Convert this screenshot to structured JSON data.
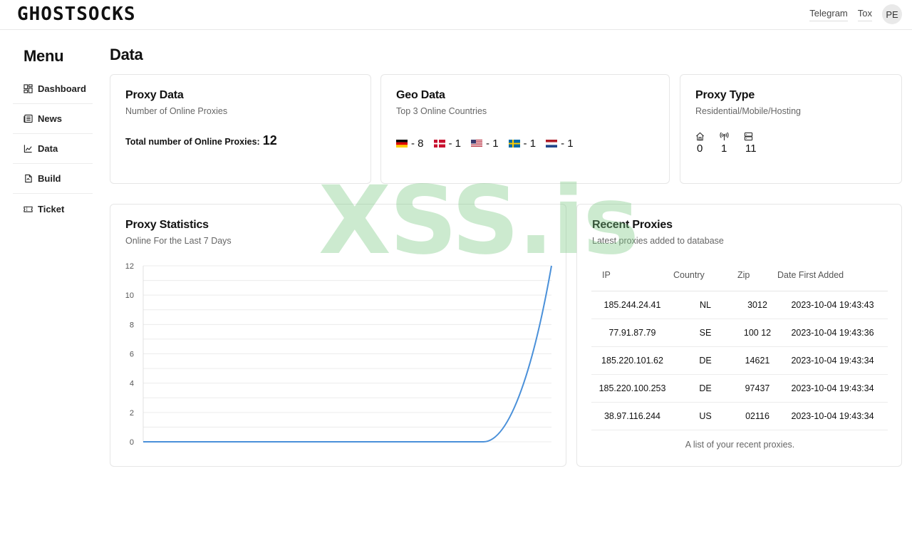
{
  "header": {
    "logo_text": "GHOSTSOCKS",
    "links": [
      "Telegram",
      "Tox"
    ],
    "avatar_initials": "PE"
  },
  "sidebar": {
    "title": "Menu",
    "items": [
      {
        "label": "Dashboard",
        "icon": "dashboard-icon"
      },
      {
        "label": "News",
        "icon": "newspaper-icon"
      },
      {
        "label": "Data",
        "icon": "chart-icon"
      },
      {
        "label": "Build",
        "icon": "file-build-icon"
      },
      {
        "label": "Ticket",
        "icon": "ticket-icon"
      }
    ]
  },
  "page_title": "Data",
  "proxy_data": {
    "title": "Proxy Data",
    "subtitle": "Number of Online Proxies",
    "total_label": "Total number of Online Proxies:",
    "total_value": "12"
  },
  "geo_data": {
    "title": "Geo Data",
    "subtitle": "Top 3 Online Countries",
    "countries": [
      {
        "code": "DE",
        "count": "- 8"
      },
      {
        "code": "DK",
        "count": "- 1"
      },
      {
        "code": "US",
        "count": "- 1"
      },
      {
        "code": "SE",
        "count": "- 1"
      },
      {
        "code": "NL",
        "count": "- 1"
      }
    ]
  },
  "proxy_type": {
    "title": "Proxy Type",
    "subtitle": "Residential/Mobile/Hosting",
    "types": [
      {
        "icon": "home-icon",
        "value": "0"
      },
      {
        "icon": "antenna-icon",
        "value": "1"
      },
      {
        "icon": "server-icon",
        "value": "11"
      }
    ]
  },
  "proxy_statistics": {
    "title": "Proxy Statistics",
    "subtitle": "Online For the Last 7 Days"
  },
  "chart_data": {
    "type": "line",
    "title": "",
    "xlabel": "",
    "ylabel": "",
    "ylim": [
      0,
      12
    ],
    "yticks": [
      0,
      2,
      4,
      6,
      8,
      10,
      12
    ],
    "grid": true,
    "x": [
      0,
      1,
      2,
      3,
      4,
      5,
      6
    ],
    "values": [
      0,
      0,
      0,
      0,
      0,
      0,
      12
    ]
  },
  "recent_proxies": {
    "title": "Recent Proxies",
    "subtitle": "Latest proxies added to database",
    "columns": [
      "IP",
      "Country",
      "Zip",
      "Date First Added"
    ],
    "rows": [
      [
        "185.244.24.41",
        "NL",
        "3012",
        "2023-10-04 19:43:43"
      ],
      [
        "77.91.87.79",
        "SE",
        "100 12",
        "2023-10-04 19:43:36"
      ],
      [
        "185.220.101.62",
        "DE",
        "14621",
        "2023-10-04 19:43:34"
      ],
      [
        "185.220.100.253",
        "DE",
        "97437",
        "2023-10-04 19:43:34"
      ],
      [
        "38.97.116.244",
        "US",
        "02116",
        "2023-10-04 19:43:34"
      ]
    ],
    "caption": "A list of your recent proxies."
  },
  "watermark": "XSS.is",
  "colors": {
    "line": "#4a90d9",
    "border": "#e6e6e6",
    "watermark": "#78c882"
  }
}
